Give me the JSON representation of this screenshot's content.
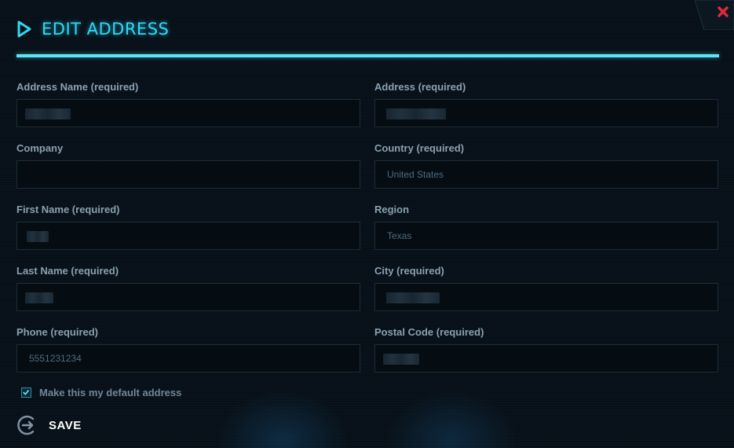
{
  "dialog": {
    "title": "EDIT ADDRESS",
    "icons": {
      "title": "play-icon",
      "close": "close-icon",
      "save": "save-icon",
      "checkbox": "check-icon"
    },
    "colors": {
      "accent": "#2fd8f4",
      "close": "#e0283c",
      "background": "#071018"
    }
  },
  "form": {
    "address_name": {
      "label": "Address Name (required)",
      "value": ""
    },
    "address": {
      "label": "Address (required)",
      "value": ""
    },
    "company": {
      "label": "Company",
      "value": ""
    },
    "country": {
      "label": "Country (required)",
      "value": "United States"
    },
    "first_name": {
      "label": "First Name (required)",
      "value": ""
    },
    "region": {
      "label": "Region",
      "value": "Texas"
    },
    "last_name": {
      "label": "Last Name (required)",
      "value": ""
    },
    "city": {
      "label": "City (required)",
      "value": ""
    },
    "phone": {
      "label": "Phone (required)",
      "value": "5551231234"
    },
    "postal_code": {
      "label": "Postal Code (required)",
      "value": ""
    },
    "default_address": {
      "label": "Make this my default address",
      "checked": true
    }
  },
  "actions": {
    "save_label": "SAVE"
  }
}
